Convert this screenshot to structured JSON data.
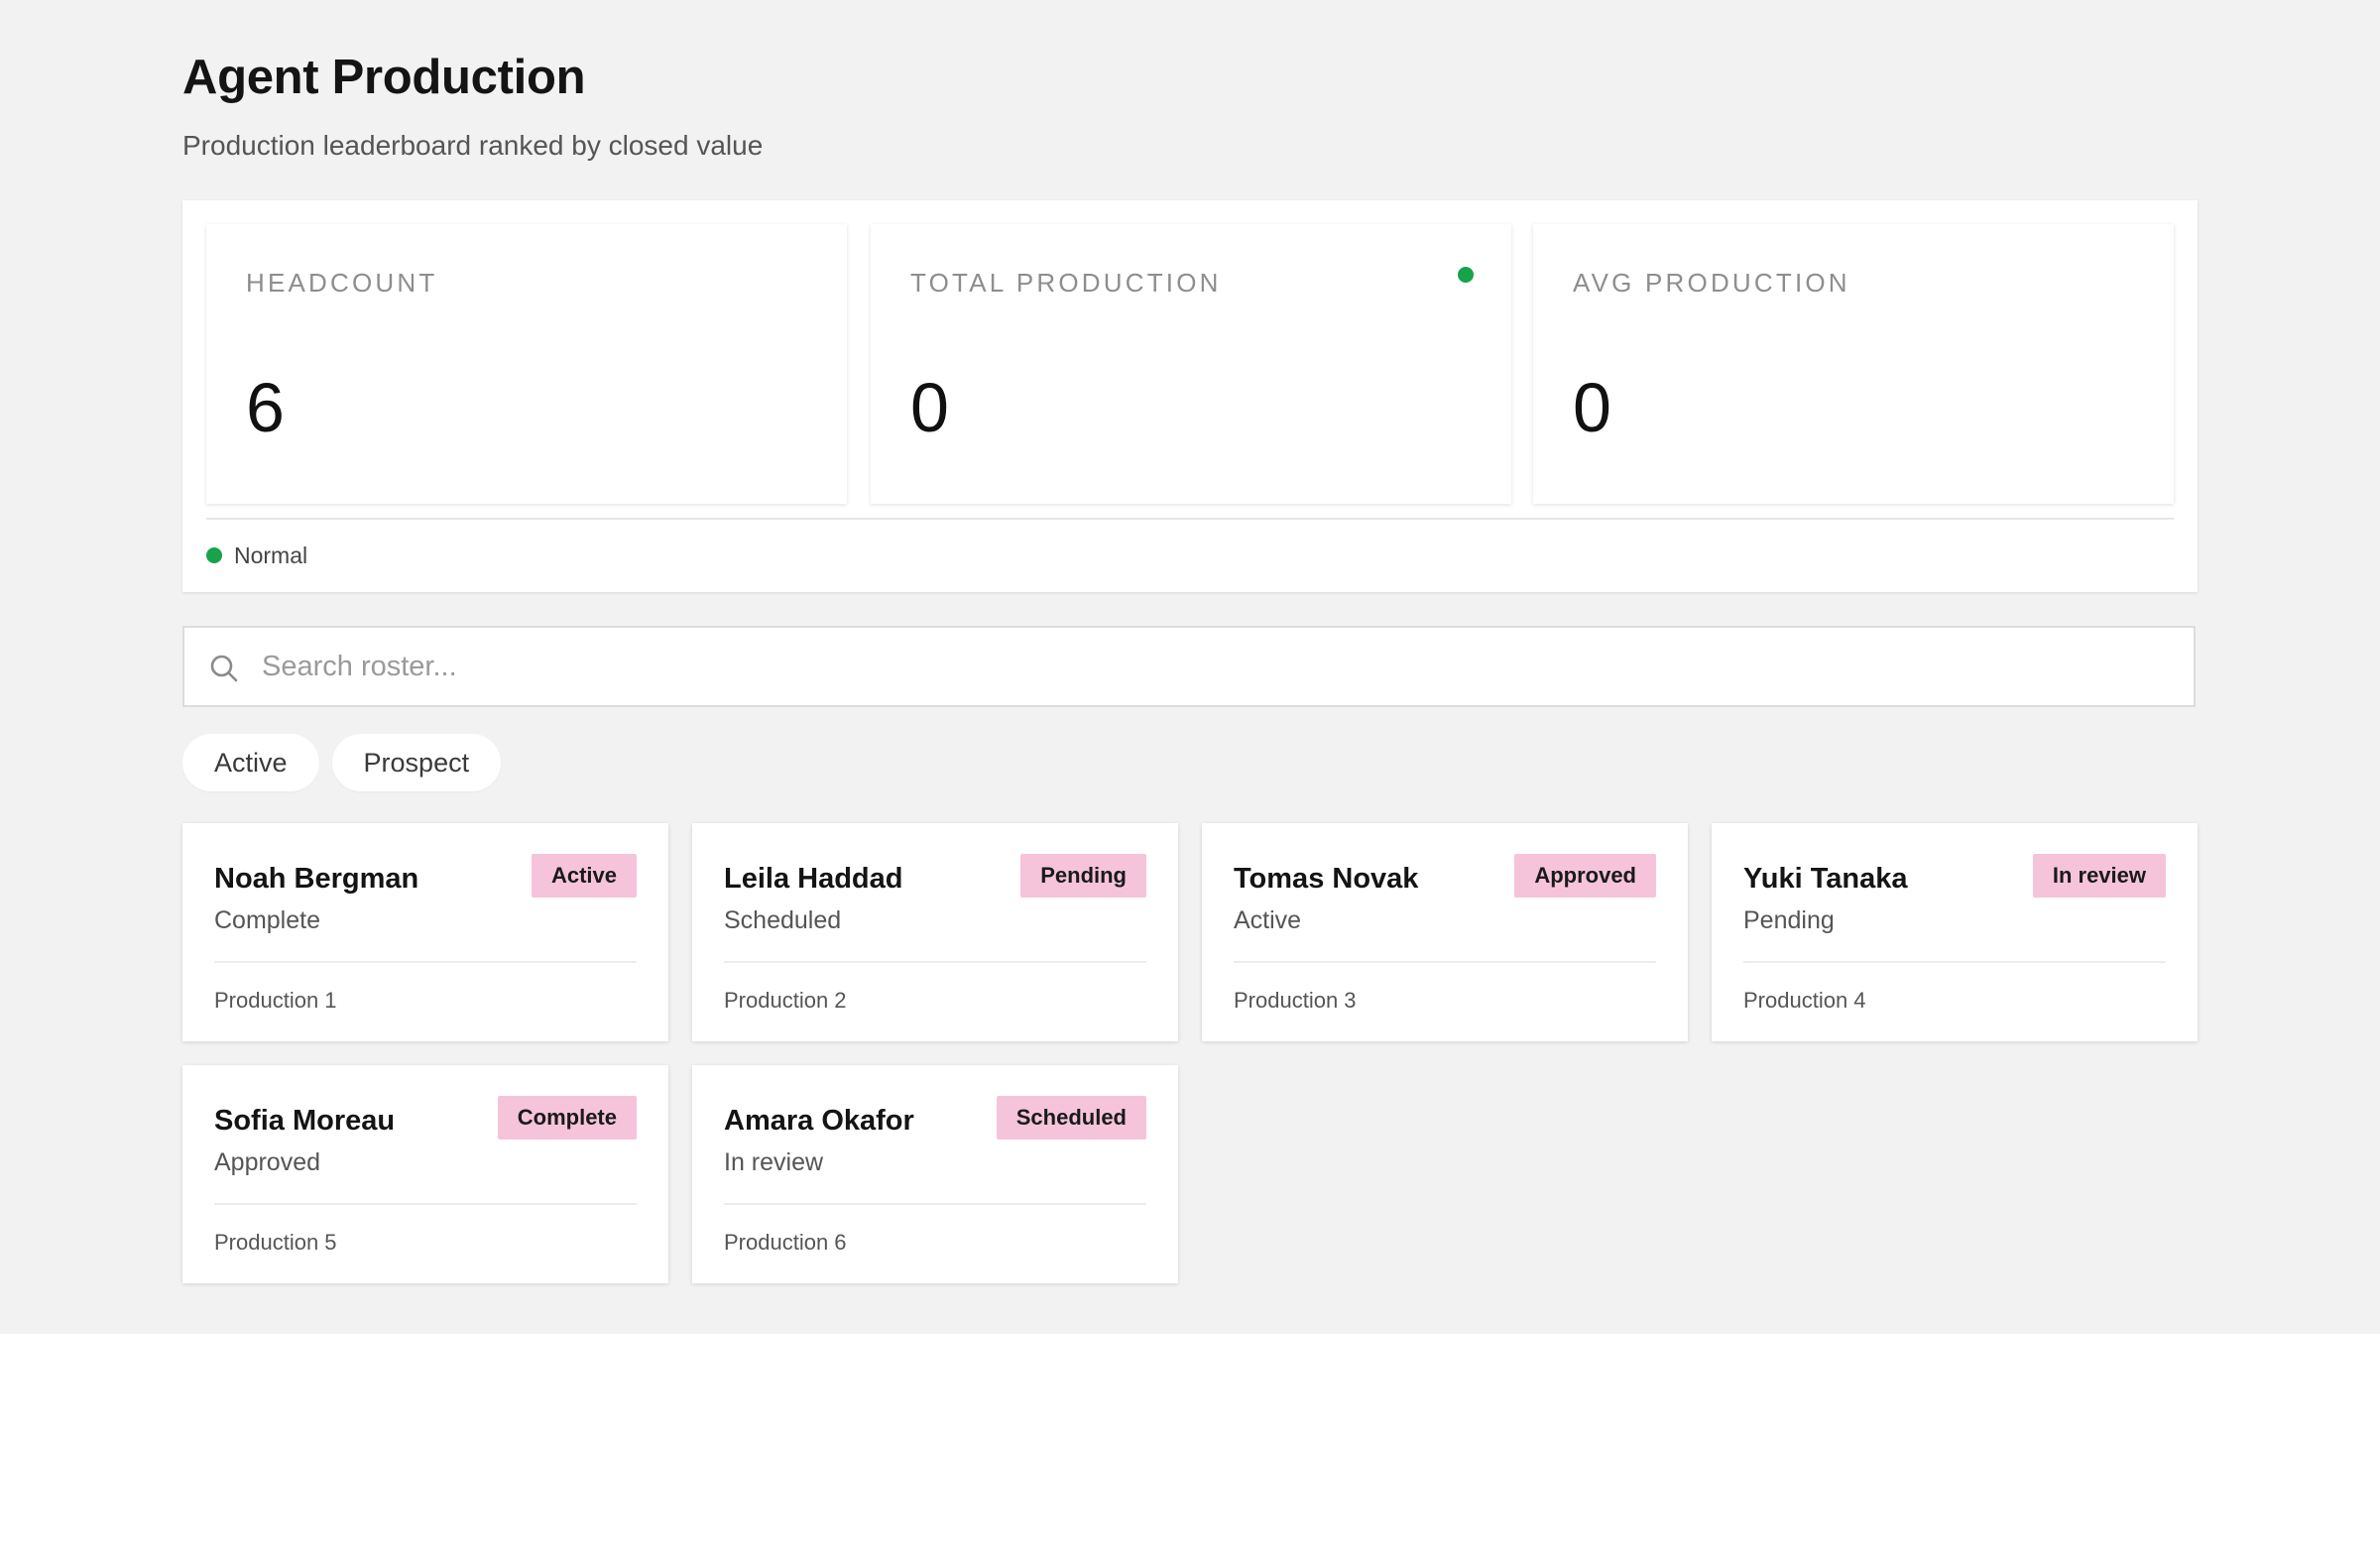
{
  "header": {
    "title": "Agent Production",
    "subtitle": "Production leaderboard ranked by closed value"
  },
  "stats": [
    {
      "label": "HEADCOUNT",
      "value": "6"
    },
    {
      "label": "TOTAL PRODUCTION",
      "value": "0"
    },
    {
      "label": "AVG PRODUCTION",
      "value": "0"
    }
  ],
  "status": {
    "label": "Normal",
    "color": "#16a34a"
  },
  "search": {
    "placeholder": "Search roster...",
    "value": ""
  },
  "filters": [
    {
      "label": "Active"
    },
    {
      "label": "Prospect"
    }
  ],
  "roster": [
    {
      "name": "Noah Bergman",
      "badge": "Active",
      "status": "Complete",
      "production": "Production 1"
    },
    {
      "name": "Leila Haddad",
      "badge": "Pending",
      "status": "Scheduled",
      "production": "Production 2"
    },
    {
      "name": "Tomas Novak",
      "badge": "Approved",
      "status": "Active",
      "production": "Production 3"
    },
    {
      "name": "Yuki Tanaka",
      "badge": "In review",
      "status": "Pending",
      "production": "Production 4"
    },
    {
      "name": "Sofia Moreau",
      "badge": "Complete",
      "status": "Approved",
      "production": "Production 5"
    },
    {
      "name": "Amara Okafor",
      "badge": "Scheduled",
      "status": "In review",
      "production": "Production 6"
    }
  ],
  "colors": {
    "background": "#f2f2f2",
    "badge": "#f6c4da",
    "status_dot": "#16a34a"
  }
}
